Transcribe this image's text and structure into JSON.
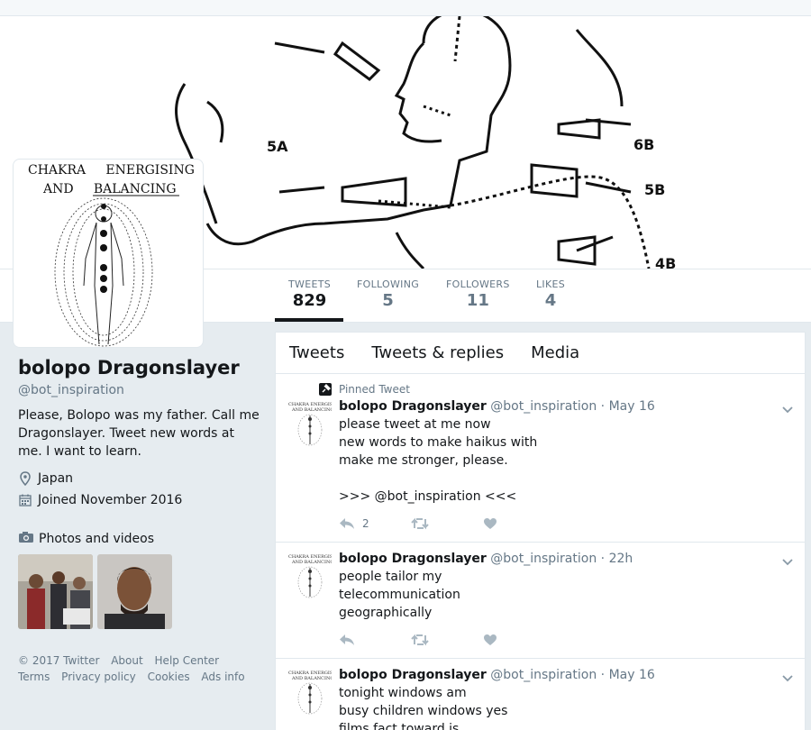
{
  "profile": {
    "name": "bolopo Dragonslayer",
    "handle": "@bot_inspiration",
    "bio": "Please, Bolopo was my father. Call me Dragonslayer. Tweet new words at me. I want to learn.",
    "location": "Japan",
    "joined": "Joined November 2016",
    "avatar_title_line1": "CHAKRA     ENERGISING",
    "avatar_title_line2": "AND     BALANCING"
  },
  "banner": {
    "labels": [
      "5A",
      "6B",
      "5B",
      "4B"
    ]
  },
  "stats": [
    {
      "label": "Tweets",
      "value": "829"
    },
    {
      "label": "Following",
      "value": "5"
    },
    {
      "label": "Followers",
      "value": "11"
    },
    {
      "label": "Likes",
      "value": "4"
    }
  ],
  "photos": {
    "heading": "Photos and videos"
  },
  "footer": {
    "links": [
      "© 2017 Twitter",
      "About",
      "Help Center",
      "Terms",
      "Privacy policy",
      "Cookies",
      "Ads info"
    ]
  },
  "timeline": {
    "tabs": [
      "Tweets",
      "Tweets & replies",
      "Media"
    ],
    "pinned_label": "Pinned Tweet",
    "tweets": [
      {
        "name": "bolopo Dragonslayer",
        "handle": "@bot_inspiration",
        "time": "· May 16",
        "text": "please tweet at me now\nnew words to make haikus with\nmake me stronger, please.\n\n>>> @bot_inspiration  <<<",
        "replies": "2"
      },
      {
        "name": "bolopo Dragonslayer",
        "handle": "@bot_inspiration",
        "time": "· 22h",
        "text": "people tailor my\ntelecommunication\ngeographically",
        "replies": ""
      },
      {
        "name": "bolopo Dragonslayer",
        "handle": "@bot_inspiration",
        "time": "· May 16",
        "text": "tonight windows am\nbusy children windows yes\nfilms fact toward is",
        "replies": ""
      }
    ]
  },
  "colors": {
    "background": "#e6ecf0",
    "secondary_text": "#657786",
    "text": "#14171a"
  }
}
